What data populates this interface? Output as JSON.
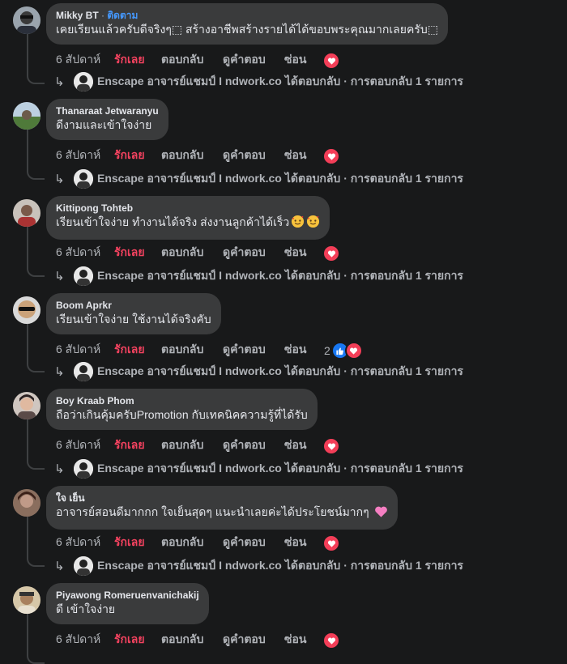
{
  "actions": {
    "time": "6 สัปดาห์",
    "love": "รักเลย",
    "reply": "ตอบกลับ",
    "translate": "ดูคำตอบ",
    "hide": "ซ่อน"
  },
  "reply_summary": {
    "author": "Enscape อาจารย์แชมป์ I ndwork.co",
    "text": "ได้ตอบกลับ · การตอบกลับ 1 รายการ"
  },
  "comments": [
    {
      "author": "Mikky BT",
      "follow": "ติดตาม",
      "text": "เคยเรียนแล้วครับดีจริงๆ\u0001 สร้างอาชีพสร้างรายได้ได้ขอบพระคุณมากเลยครับ\u0001",
      "text_display": "เคยเรียนแล้วครับดีจริงๆ⬚ สร้างอาชีพสร้างรายได้ได้ขอบพระคุณมากเลยครับ⬚",
      "reactions": {
        "count": "",
        "types": [
          "heart"
        ]
      }
    },
    {
      "author": "Thanaraat Jetwaranyu",
      "text_display": "ดีงามและเข้าใจง่าย",
      "reactions": {
        "count": "",
        "types": [
          "heart"
        ]
      }
    },
    {
      "author": "Kittipong Tohteb",
      "text_display": "เรียนเข้าใจง่าย ทำงานได้จริง ส่งงานลูกค้าได้เร็ว",
      "emojis": [
        "smiling-face-hearts",
        "smiling-face-hearts"
      ],
      "reactions": {
        "count": "",
        "types": [
          "heart"
        ]
      }
    },
    {
      "author": "Boom Aprkr",
      "text_display": "เรียนเข้าใจง่าย ใช้งานได้จริงคับ",
      "reactions": {
        "count": "2",
        "types": [
          "like",
          "heart"
        ]
      }
    },
    {
      "author": "Boy Kraab Phom",
      "text_display": "ถือว่าเกินคุ้มครับPromotion กับเทคนิคความรู้ที่ได้รับ",
      "reactions": {
        "count": "",
        "types": [
          "heart"
        ]
      }
    },
    {
      "author": "ใจ เย็น",
      "text_display": "อาจารย์สอนดีมากกก ใจเย็นสุดๆ แนะนำเลยค่ะได้ประโยชน์มากๆ",
      "emojis": [
        "pink-heart"
      ],
      "reactions": {
        "count": "",
        "types": [
          "heart"
        ]
      }
    },
    {
      "author": "Piyawong Romeruenvanichakij",
      "text_display": "ดี เข้าใจง่าย",
      "reactions": {
        "count": "",
        "types": [
          "heart"
        ]
      }
    }
  ],
  "colors": {
    "background": "#18191a",
    "bubble": "#3a3b3c",
    "love": "#f3425f",
    "follow": "#4599ff",
    "muted": "#b0b3b8"
  }
}
